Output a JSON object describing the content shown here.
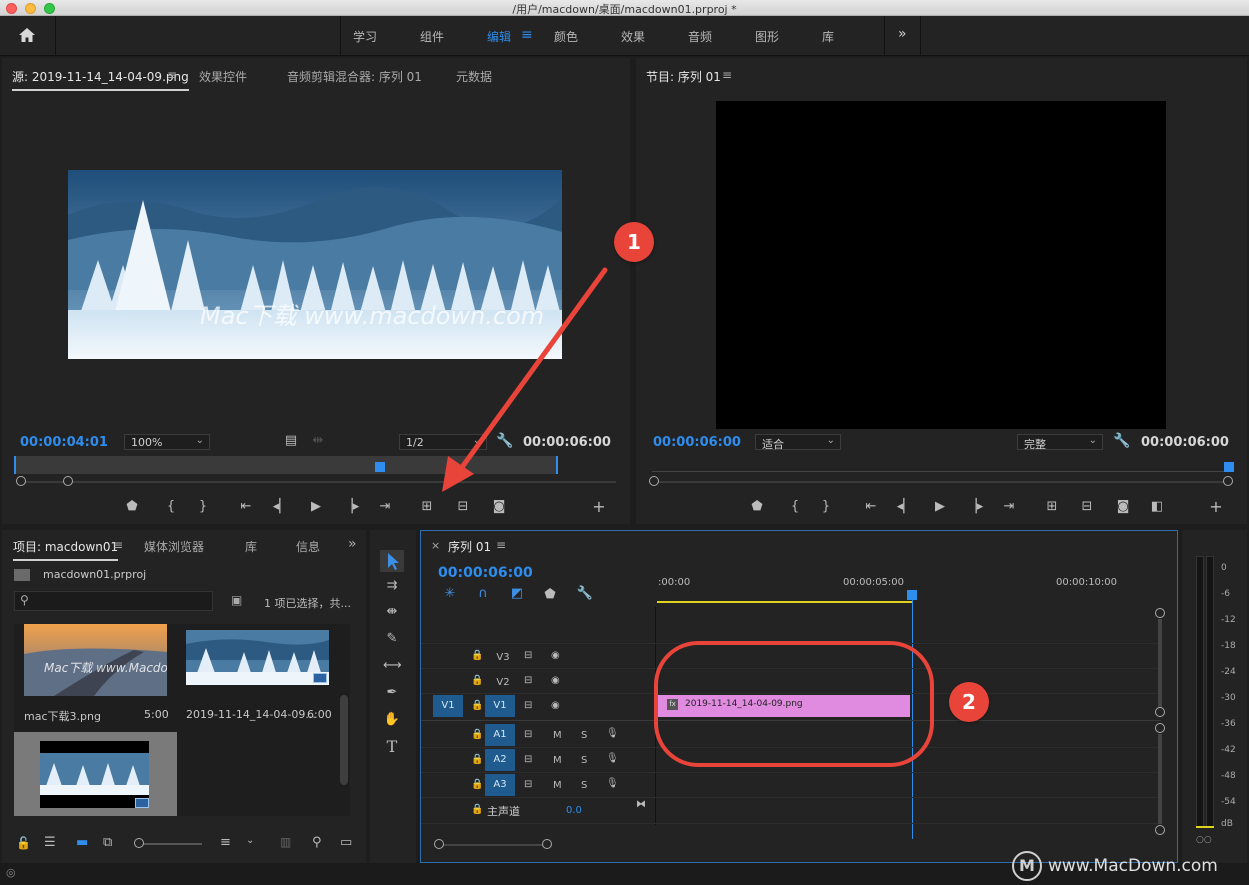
{
  "window": {
    "title": "/用户/macdown/桌面/macdown01.prproj *"
  },
  "workspaces": {
    "items": [
      "学习",
      "组件",
      "编辑",
      "颜色",
      "效果",
      "音频",
      "图形",
      "库"
    ],
    "active": "编辑",
    "more": "»"
  },
  "source_monitor": {
    "tabs": [
      "源: 2019-11-14_14-04-09.png",
      "效果控件",
      "音频剪辑混合器: 序列 01",
      "元数据"
    ],
    "menu_icon": "≡",
    "current_time": "00:00:04:01",
    "zoom": "100%",
    "resolution": "1/2",
    "duration": "00:00:06:00",
    "watermark_text": "Mac下载 www.macdown.com"
  },
  "program_monitor": {
    "title": "节目: 序列 01",
    "menu_icon": "≡",
    "current_time": "00:00:06:00",
    "fit": "适合",
    "quality": "完整",
    "duration": "00:00:06:00"
  },
  "callouts": {
    "one": "1",
    "two": "2"
  },
  "project_panel": {
    "tabs": [
      "项目: macdown01",
      "媒体浏览器",
      "库",
      "信息"
    ],
    "menu_icon": "≡",
    "more": "»",
    "project_file": "macdown01.prproj",
    "search_placeholder": "",
    "selection_status": "1 项已选择，共...",
    "items": [
      {
        "name": "mac下载3.png",
        "duration": "5:00",
        "thumb_text": "Mac下载 www.Macdown.com"
      },
      {
        "name": "2019-11-14_14-04-09...",
        "duration": "6:00"
      },
      {
        "name": "",
        "duration": ""
      }
    ]
  },
  "timeline": {
    "tab": "序列 01",
    "close": "×",
    "menu_icon": "≡",
    "current_time": "00:00:06:00",
    "ruler": [
      ":00:00",
      "00:00:05:00",
      "00:00:10:00"
    ],
    "video_tracks": [
      "V3",
      "V2",
      "V1"
    ],
    "source_patch": "V1",
    "audio_tracks": [
      "A1",
      "A2",
      "A3"
    ],
    "mute": "M",
    "solo": "S",
    "master_label": "主声道",
    "master_value": "0.0",
    "clip": {
      "name": "2019-11-14_14-04-09.png",
      "fx": "fx",
      "color": "#e18be0"
    }
  },
  "audio_meter": {
    "labels": [
      "0",
      "-6",
      "-12",
      "-18",
      "-24",
      "-30",
      "-36",
      "-42",
      "-48",
      "-54",
      "dB"
    ]
  },
  "footer": {
    "watermark": "www.MacDown.com"
  },
  "colors": {
    "accent": "#2e8ded",
    "callout": "#e8443a",
    "clip": "#e18be0",
    "work_area": "#e1d41f"
  }
}
